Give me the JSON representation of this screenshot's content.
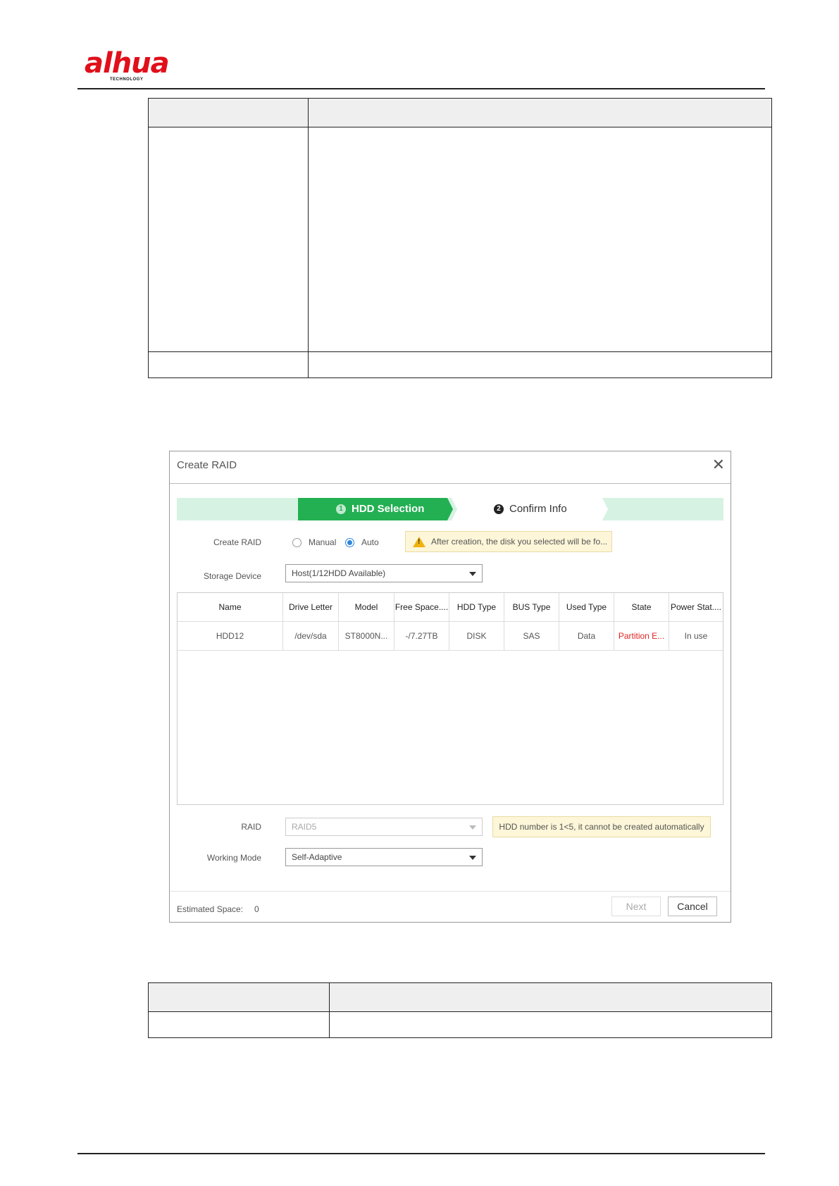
{
  "header": {
    "logo_text": "alhua",
    "logo_sub": "TECHNOLOGY"
  },
  "dialog": {
    "title": "Create RAID",
    "close_icon": "close-icon",
    "steps": [
      {
        "num": "1",
        "label": "HDD Selection",
        "active": true
      },
      {
        "num": "2",
        "label": "Confirm Info",
        "active": false
      }
    ],
    "create_raid_label": "Create RAID",
    "manual_label": "Manual",
    "auto_label": "Auto",
    "selected_mode": "Auto",
    "warning_text": "After creation, the disk you selected will be fo...",
    "storage_device_label": "Storage Device",
    "storage_device_value": "Host(1/12HDD Available)",
    "table": {
      "columns": [
        "Name",
        "Drive Letter",
        "Model",
        "Free Space....",
        "HDD Type",
        "BUS Type",
        "Used Type",
        "State",
        "Power Stat...."
      ],
      "rows": [
        [
          "HDD12",
          "/dev/sda",
          "ST8000N...",
          "-/7.27TB",
          "DISK",
          "SAS",
          "Data",
          "Partition E...",
          "In use"
        ]
      ]
    },
    "raid_label": "RAID",
    "raid_value": "RAID5",
    "raid_tip": "HDD number is 1<5, it cannot be created automatically",
    "working_mode_label": "Working Mode",
    "working_mode_value": "Self-Adaptive",
    "estimated_space_label": "Estimated Space:",
    "estimated_space_value": "0",
    "next_label": "Next",
    "cancel_label": "Cancel"
  },
  "colors": {
    "brand": "#e0101b",
    "step_active": "#23b052",
    "step_bar": "#d6f2e3",
    "error": "#e02424",
    "warning_bg": "#fdf6d8"
  }
}
